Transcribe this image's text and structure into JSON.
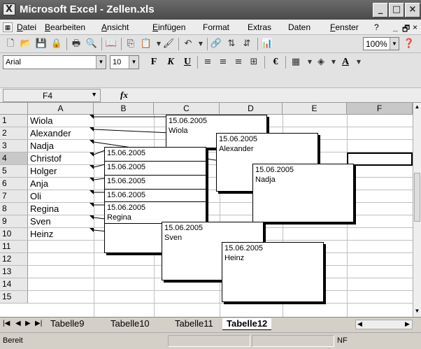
{
  "window": {
    "title": "Microsoft Excel - Zellen.xls"
  },
  "menu": [
    "Datei",
    "Bearbeiten",
    "Ansicht",
    "Einfügen",
    "Format",
    "Extras",
    "Daten",
    "Fenster",
    "?"
  ],
  "toolbar": {
    "zoom": "100%"
  },
  "format_toolbar": {
    "font": "Arial",
    "size": "10",
    "bold": "F",
    "italic": "K",
    "underline": "U",
    "currency": "€"
  },
  "formula_bar": {
    "name_box": "F4",
    "fx": "fx"
  },
  "columns": [
    "A",
    "B",
    "C",
    "D",
    "E",
    "F"
  ],
  "rows": [
    "1",
    "2",
    "3",
    "4",
    "5",
    "6",
    "7",
    "8",
    "9",
    "10",
    "11",
    "12",
    "13",
    "14",
    "15"
  ],
  "cells_a": [
    "Wiola",
    "Alexander",
    "Nadja",
    "Christof",
    "Holger",
    "Anja",
    "Oli",
    "Regina",
    "Sven",
    "Heinz"
  ],
  "comments": [
    {
      "date": "15.06.2005",
      "name": "Wiola"
    },
    {
      "date": "15.06.2005",
      "name": "Alexander"
    },
    {
      "date": "15.06.2005",
      "name": ""
    },
    {
      "date": "15.06.2005",
      "name": "Nadja"
    },
    {
      "date": "15.06.2005",
      "name": ""
    },
    {
      "date": "15.06.2005",
      "name": ""
    },
    {
      "date": "15.06.2005",
      "name": ""
    },
    {
      "date": "15.06.2005",
      "name": "Regina"
    },
    {
      "date": "15.06.2005",
      "name": "Sven"
    },
    {
      "date": "15.06.2005",
      "name": "Heinz"
    }
  ],
  "tabs": [
    "Tabelle9",
    "Tabelle10",
    "Tabelle11",
    "Tabelle12"
  ],
  "active_tab": "Tabelle12",
  "status": {
    "text": "Bereit",
    "nf": "NF"
  }
}
